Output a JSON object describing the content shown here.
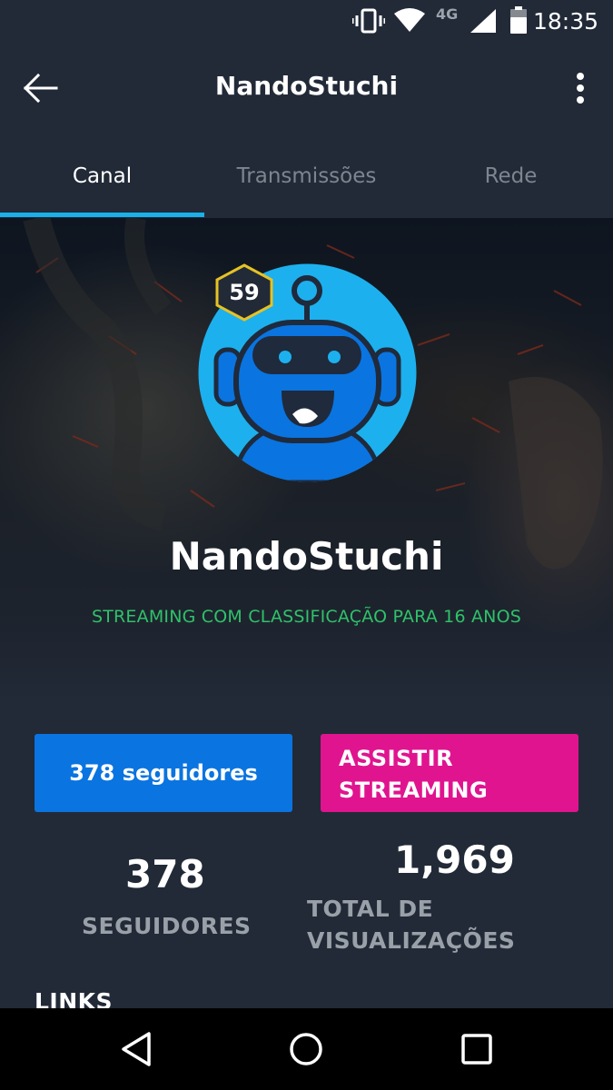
{
  "status_bar": {
    "time": "18:35",
    "network": "4G",
    "icons": [
      "vibrate-icon",
      "wifi-icon",
      "signal-icon",
      "battery-icon"
    ]
  },
  "app_bar": {
    "title": "NandoStuchi",
    "icons": [
      "back-arrow-icon",
      "more-vert-icon"
    ]
  },
  "tabs": [
    {
      "label": "Canal",
      "active": true
    },
    {
      "label": "Transmissões",
      "active": false
    },
    {
      "label": "Rede",
      "active": false
    }
  ],
  "profile": {
    "level": "59",
    "name": "NandoStuchi",
    "rating": "STREAMING COM CLASSIFICAÇÃO PARA 16 ANOS",
    "avatar_icon": "robot-avatar-icon"
  },
  "actions": {
    "follow_label": "378 seguidores",
    "watch_label": "ASSISTIR\nSTREAMING"
  },
  "stats": {
    "followers_count": "378",
    "followers_label": "SEGUIDORES",
    "views_count": "1,969",
    "views_label": "TOTAL DE\nVISUALIZAÇÕES"
  },
  "links_heading": "LINKS",
  "nav_bar": {
    "icons": [
      "back-triangle-icon",
      "home-circle-icon",
      "recents-square-icon"
    ]
  },
  "colors": {
    "background": "#222a38",
    "accent": "#1ab0ea",
    "follow_button": "#0a74e0",
    "watch_button": "#e0148f",
    "rating_text": "#2ec26a",
    "level_badge_border": "#e6c224"
  }
}
